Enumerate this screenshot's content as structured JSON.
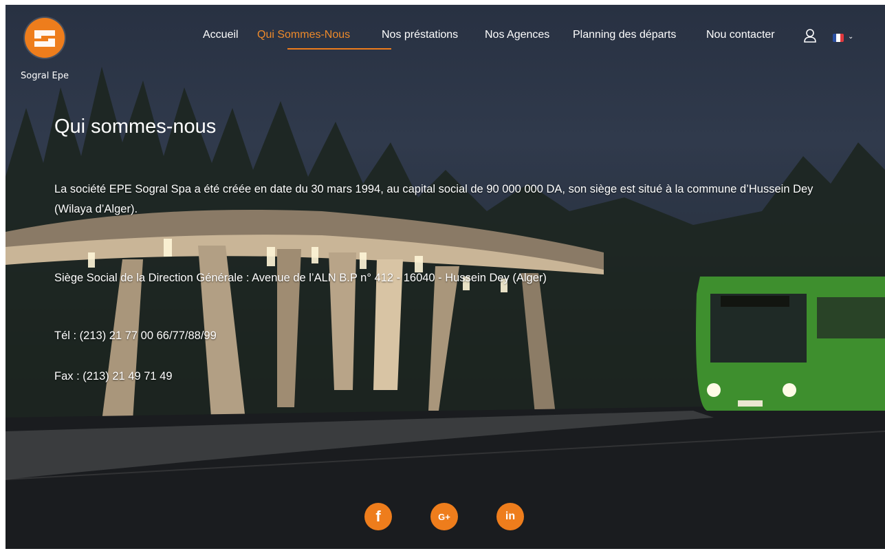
{
  "brand": {
    "name": "Sogral Epe",
    "logo_color": "#ee7d1c"
  },
  "nav": {
    "items": [
      {
        "label": "Accueil",
        "active": false
      },
      {
        "label": "Qui Sommes-Nous",
        "active": true
      },
      {
        "label": "Nos préstations",
        "active": false
      },
      {
        "label": "Nos Agences",
        "active": false
      },
      {
        "label": "Planning des départs",
        "active": false
      },
      {
        "label": "Nou contacter",
        "active": false
      }
    ],
    "icons": [
      "user-icon",
      "french-flag-icon",
      "chevron-down-icon"
    ]
  },
  "content": {
    "title": "Qui sommes-nous",
    "intro": "La société EPE Sogral Spa a été créée en date du 30 mars 1994, au capital social de 90 000 000 DA, son siège est situé à la commune d’Hussein Dey (Wilaya d’Alger).",
    "address": "Siège Social de la Direction Générale : Avenue de l’ALN B.P n° 412  - 16040 - Hussein Dey (Alger)",
    "phone": "Tél : (213) 21 77 00 66/77/88/99",
    "fax": "Fax : (213) 21 49 71 49"
  },
  "social": [
    {
      "name": "facebook",
      "glyph": "f"
    },
    {
      "name": "google-plus",
      "glyph": "G+"
    },
    {
      "name": "linkedin",
      "glyph": "in"
    }
  ],
  "colors": {
    "accent": "#ee7d1c",
    "text": "#ffffff"
  }
}
